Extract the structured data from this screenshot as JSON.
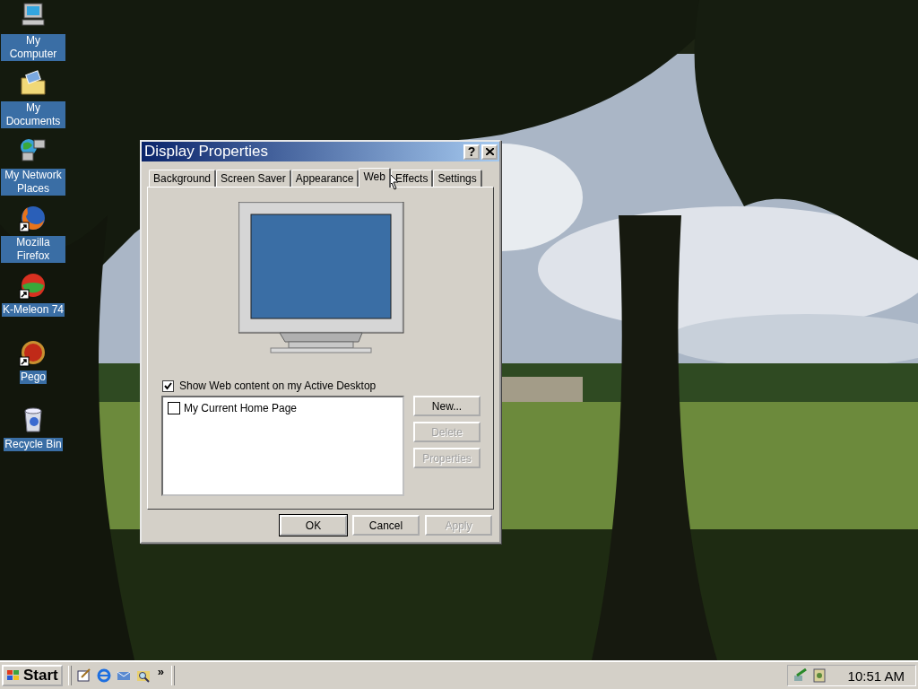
{
  "desktop_icons": [
    {
      "label": "My Computer",
      "kind": "computer",
      "shortcut": false
    },
    {
      "label": "My Documents",
      "kind": "documents",
      "shortcut": false
    },
    {
      "label": "My Network Places",
      "kind": "network",
      "shortcut": false
    },
    {
      "label": "Mozilla Firefox",
      "kind": "firefox",
      "shortcut": true
    },
    {
      "label": "K-Meleon 74",
      "kind": "kmeleon",
      "shortcut": true
    },
    {
      "label": "Pego",
      "kind": "pego",
      "shortcut": true
    },
    {
      "label": "Recycle Bin",
      "kind": "recycle",
      "shortcut": false
    }
  ],
  "dialog": {
    "title": "Display Properties",
    "help_button": "?",
    "tabs": [
      {
        "label": "Background",
        "selected": false
      },
      {
        "label": "Screen Saver",
        "selected": false
      },
      {
        "label": "Appearance",
        "selected": false
      },
      {
        "label": "Web",
        "selected": true
      },
      {
        "label": "Effects",
        "selected": false
      },
      {
        "label": "Settings",
        "selected": false
      }
    ],
    "show_web_content": {
      "label": "Show Web content on my Active Desktop",
      "checked": true
    },
    "web_items": [
      {
        "label": "My Current Home Page",
        "checked": false
      }
    ],
    "side_buttons": [
      {
        "label": "New...",
        "disabled": false
      },
      {
        "label": "Delete",
        "disabled": true
      },
      {
        "label": "Properties",
        "disabled": true
      }
    ],
    "footer_buttons": [
      {
        "label": "OK",
        "disabled": false,
        "default": true
      },
      {
        "label": "Cancel",
        "disabled": false,
        "default": false
      },
      {
        "label": "Apply",
        "disabled": true,
        "default": false
      }
    ]
  },
  "taskbar": {
    "start_label": "Start",
    "chevron": "»",
    "clock": "10:51 AM"
  }
}
